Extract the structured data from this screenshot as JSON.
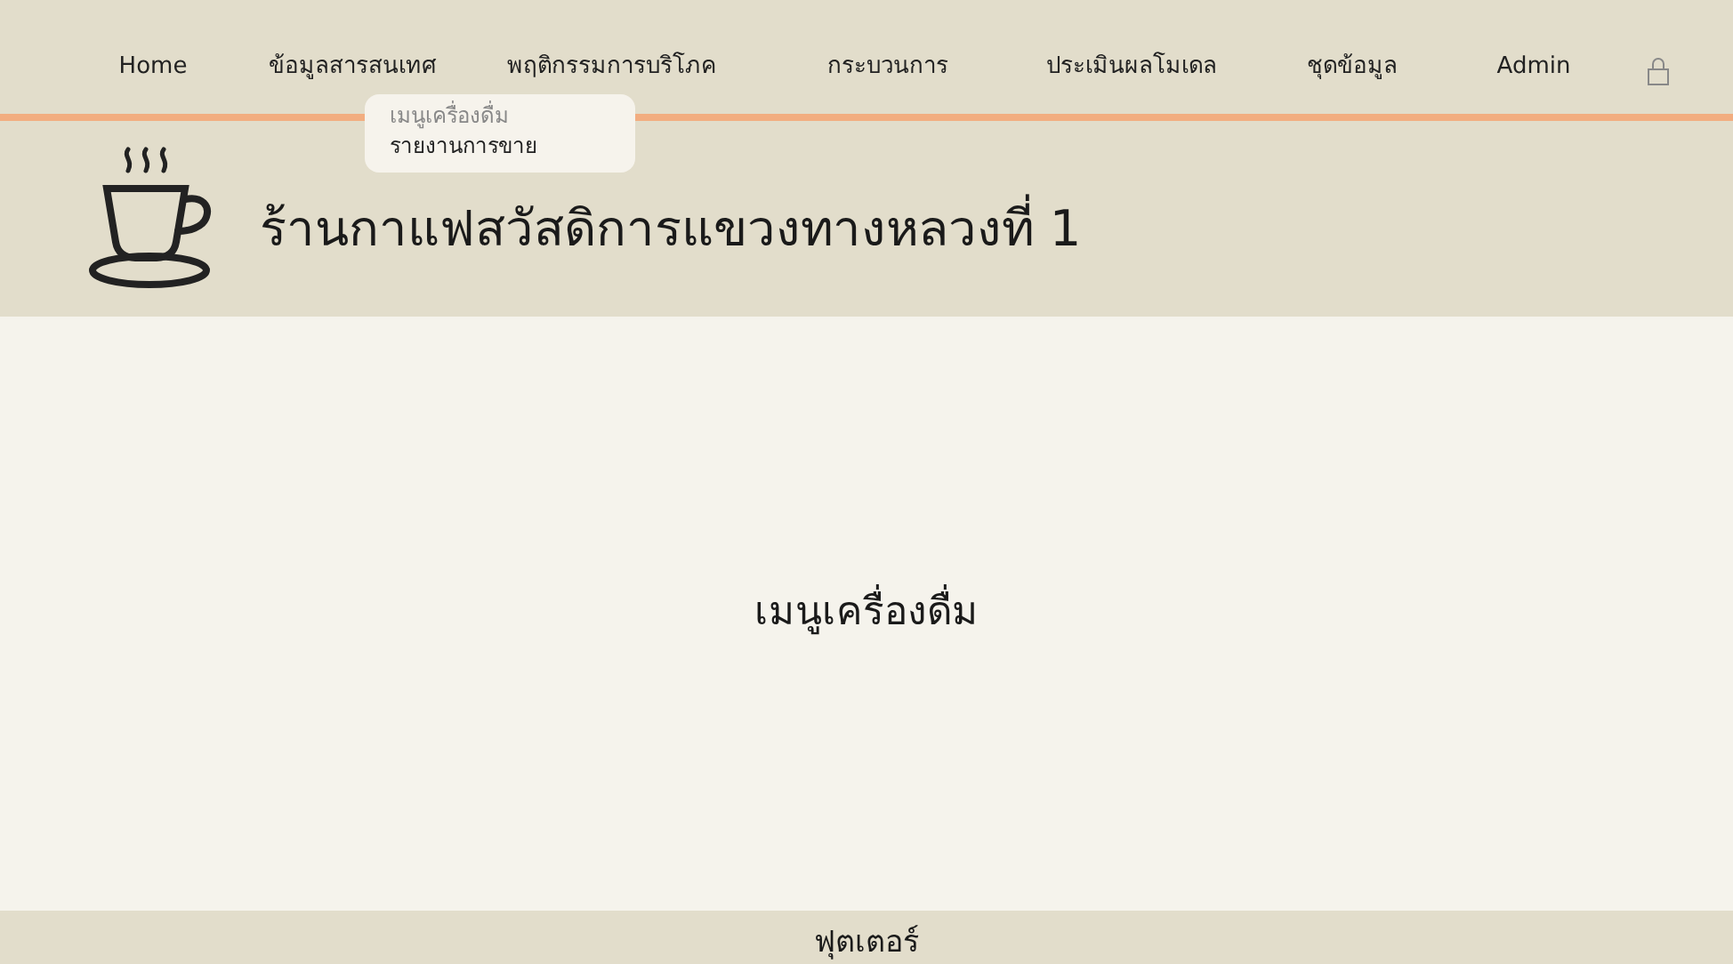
{
  "nav": {
    "items": [
      {
        "label": "Home"
      },
      {
        "label": "ข้อมูลสารสนเทศ",
        "dropdown": [
          {
            "label": "เมนูเครื่องดื่ม",
            "selected": true
          },
          {
            "label": "รายงานการขาย",
            "selected": false
          }
        ]
      },
      {
        "label": "พฤติกรรมการบริโภค"
      },
      {
        "label": "กระบวนการ"
      },
      {
        "label": "ประเมินผลโมเดล"
      },
      {
        "label": "ชุดข้อมูล"
      },
      {
        "label": "Admin"
      }
    ]
  },
  "header": {
    "title": "ร้านกาแฟสวัสดิการแขวงทางหลวงที่ 1"
  },
  "main": {
    "heading": "เมนูเครื่องดื่ม"
  },
  "footer": {
    "text": "ฟุตเตอร์"
  }
}
